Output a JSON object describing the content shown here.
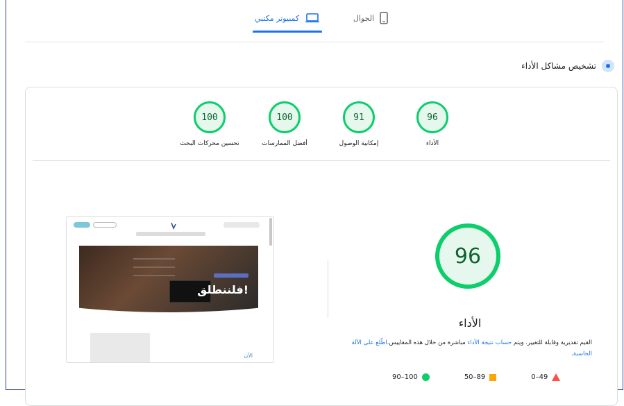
{
  "tabs": {
    "mobile_label": "الجوال",
    "desktop_label": "كمبيوتر مكتبي"
  },
  "section": {
    "title": "تشخيص مشاكل الأداء"
  },
  "gauges": [
    {
      "label": "الأداء",
      "score": "96"
    },
    {
      "label": "إمكانية الوصول",
      "score": "91"
    },
    {
      "label": "أفضل الممارسات",
      "score": "100"
    },
    {
      "label": "تحسين محركات البحث",
      "score": "100"
    }
  ],
  "main_gauge": {
    "score": "96",
    "label": "الأداء"
  },
  "note": {
    "prefix": "القيم تقديرية وقابلة للتغيير. ويتم ",
    "link1": "حساب نتيجة الأداء",
    "middle": " مباشرة من خلال هذه المقاييس.",
    "link2": "اطّلع على الآلة الحاسبة",
    "suffix": "."
  },
  "legend": {
    "fail": "0–49",
    "average": "50–89",
    "pass": "90–100"
  },
  "thumbnail": {
    "hero_text": "فلننطلق!",
    "bottom_text": "الآن"
  },
  "colors": {
    "accent": "#1a73e8",
    "pass": "#0cce6b",
    "average": "#ffa400",
    "fail": "#ff4e42"
  }
}
